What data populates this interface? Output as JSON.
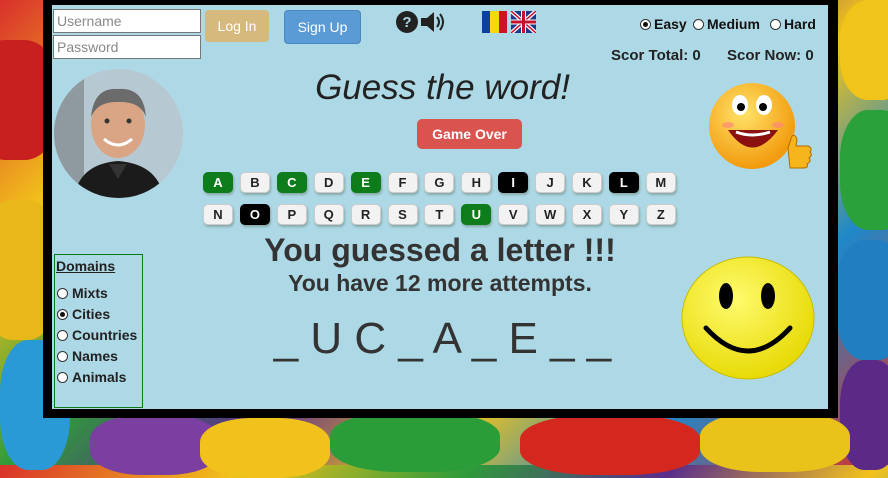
{
  "login": {
    "username_placeholder": "Username",
    "password_placeholder": "Password",
    "login_label": "Log In",
    "signup_label": "Sign Up"
  },
  "icons": {
    "help": "question-circle-icon",
    "sound": "speaker-icon",
    "flag_ro": "romania-flag-icon",
    "flag_uk": "uk-flag-icon"
  },
  "difficulty": {
    "options": [
      "Easy",
      "Medium",
      "Hard"
    ],
    "selected": "Easy"
  },
  "score": {
    "total_label": "Scor Total: 0",
    "now_label": "Scor Now: 0"
  },
  "title": "Guess the word!",
  "game_over_label": "Game Over",
  "keyboard": {
    "row1": [
      "A",
      "B",
      "C",
      "D",
      "E",
      "F",
      "G",
      "H",
      "I",
      "J",
      "K",
      "L",
      "M"
    ],
    "row2": [
      "N",
      "O",
      "P",
      "Q",
      "R",
      "S",
      "T",
      "U",
      "V",
      "W",
      "X",
      "Y",
      "Z"
    ],
    "correct": [
      "A",
      "C",
      "E",
      "U"
    ],
    "wrong": [
      "I",
      "L",
      "O"
    ]
  },
  "domains": {
    "title": "Domains",
    "options": [
      "Mixts",
      "Cities",
      "Countries",
      "Names",
      "Animals"
    ],
    "selected": "Cities"
  },
  "message": {
    "headline": "You guessed a letter !!!",
    "attempts": "You have 12 more attempts."
  },
  "word_display": "_ U C _ A _ E _ _",
  "colors": {
    "panel": "#add8e6",
    "correct": "#0d7d1c",
    "wrong": "#000000",
    "login_button": "#d6b97d",
    "signup_button": "#5b9bd5",
    "game_over": "#d9534f"
  }
}
